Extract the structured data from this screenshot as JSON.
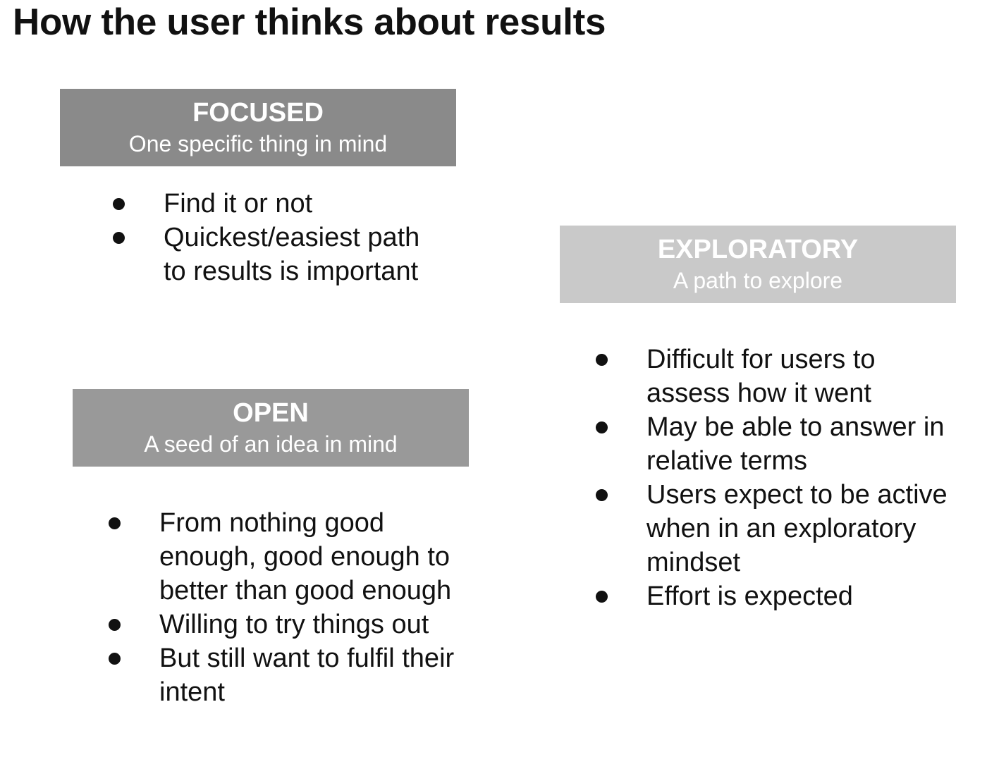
{
  "title": "How the user thinks about results",
  "colors": {
    "focused_header_bg": "#8a8a8a",
    "open_header_bg": "#999999",
    "exploratory_header_bg": "#c9c9c9",
    "header_text": "#ffffff",
    "bullet_text": "#111111"
  },
  "focused": {
    "header": "FOCUSED",
    "subheader": "One specific thing in mind",
    "bullets": [
      "Find it or not",
      "Quickest/easiest path to results is important"
    ]
  },
  "open": {
    "header": "OPEN",
    "subheader": "A seed of an idea in mind",
    "bullets": [
      "From nothing good enough, good enough to better than good enough",
      "Willing to try things out",
      "But still want to fulfil their intent"
    ]
  },
  "exploratory": {
    "header": "EXPLORATORY",
    "subheader": "A path to explore",
    "bullets": [
      "Difficult for users  to assess how it went",
      "May be able to answer in relative terms",
      "Users expect to be active when in an exploratory mindset",
      "Effort is expected"
    ]
  }
}
